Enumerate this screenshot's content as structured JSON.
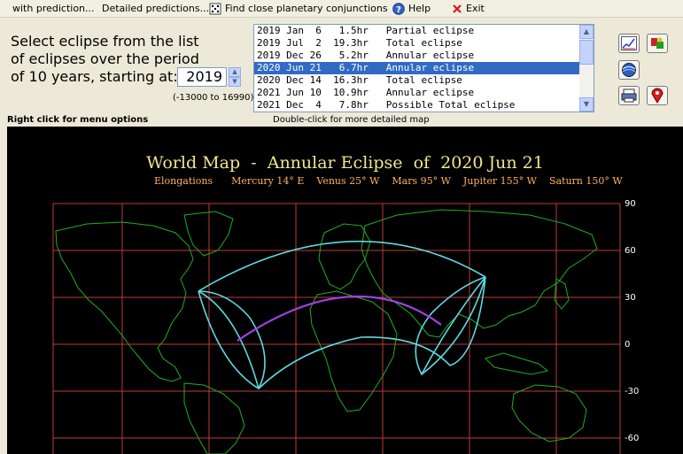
{
  "menu": {
    "items": [
      {
        "label": "with prediction...",
        "icon": ""
      },
      {
        "label": "Detailed predictions...",
        "icon": ""
      },
      {
        "label": "Find close planetary conjunctions",
        "icon": "dice-icon"
      },
      {
        "label": "Help",
        "icon": "help-icon"
      },
      {
        "label": "Exit",
        "icon": "close-icon"
      }
    ]
  },
  "prompt": {
    "line1": "Select eclipse from the list",
    "line2": "of eclipses over the period",
    "line3": "of 10 years, starting at:",
    "year": "2019",
    "range": "(-13000 to 16990)"
  },
  "eclipses": [
    {
      "date": "2019 Jan  6",
      "time": " 1.5hr",
      "type": "Partial eclipse",
      "selected": false
    },
    {
      "date": "2019 Jul  2",
      "time": "19.3hr",
      "type": "Total eclipse",
      "selected": false
    },
    {
      "date": "2019 Dec 26",
      "time": " 5.2hr",
      "type": "Annular eclipse",
      "selected": false
    },
    {
      "date": "2020 Jun 21",
      "time": " 6.7hr",
      "type": "Annular eclipse",
      "selected": true
    },
    {
      "date": "2020 Dec 14",
      "time": "16.3hr",
      "type": "Total eclipse",
      "selected": false
    },
    {
      "date": "2021 Jun 10",
      "time": "10.9hr",
      "type": "Annular eclipse",
      "selected": false
    },
    {
      "date": "2021 Dec  4",
      "time": " 7.8hr",
      "type": "Possible Total eclipse",
      "selected": false
    }
  ],
  "toolbar": {
    "buttons": [
      "chart-icon",
      "planets-icon",
      "globe-icon",
      "print-icon",
      "map-pin-icon"
    ]
  },
  "hints": {
    "right_click": "Right click for menu options",
    "double_click": "Double-click for more detailed map"
  },
  "map": {
    "title": "World Map  -  Annular Eclipse  of  2020 Jun 21",
    "elongations": "Elongations      Mercury 14° E    Venus 25° W    Mars 95° W    Jupiter 155° W    Saturn 150° W",
    "lat_labels": [
      "90",
      "60",
      "30",
      "0",
      "-30",
      "-60"
    ],
    "colors": {
      "background": "#000000",
      "grid": "#c03a3a",
      "coast": "#1fae1f",
      "path": "#5fd8e0",
      "central_line": "#a040e0",
      "title": "#f0e68c",
      "elongations": "#ffb060"
    }
  }
}
